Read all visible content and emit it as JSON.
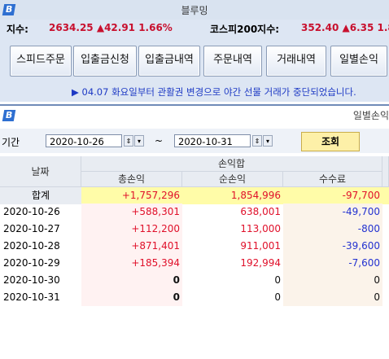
{
  "app": {
    "title": "블루밍",
    "logo_glyph": "B"
  },
  "index_bar": {
    "kospi_label": "지수:",
    "kospi_value": "2634.25 ▲42.91 1.66%",
    "kospi200_label": "코스피200지수:",
    "kospi200_value": "352.40 ▲6.35 1.83"
  },
  "nav": {
    "buttons": [
      "스피드주문",
      "입출금신청",
      "입출금내역",
      "주문내역",
      "거래내역",
      "일별손익"
    ]
  },
  "notice": {
    "text": "▶ 04.07 화요일부터 관활권 변경으로 야간 선물 거래가 중단되었습니다."
  },
  "daily_pl": {
    "window_title": "일별손익",
    "period_label": "기간",
    "start_date": "2020-10-26",
    "separator": "~",
    "end_date": "2020-10-31",
    "query_button": "조회",
    "columns": {
      "date": "날짜",
      "group": "손익합",
      "total_pl": "총손익",
      "net_pl": "순손익",
      "fee": "수수료"
    },
    "total_row": {
      "label": "합계",
      "total_pl": "+1,757,296",
      "net_pl": "1,854,996",
      "fee": "-97,700"
    },
    "rows": [
      {
        "date": "2020-10-26",
        "total_pl": "+588,301",
        "net_pl": "638,001",
        "fee": "-49,700"
      },
      {
        "date": "2020-10-27",
        "total_pl": "+112,200",
        "net_pl": "113,000",
        "fee": "-800"
      },
      {
        "date": "2020-10-28",
        "total_pl": "+871,401",
        "net_pl": "911,001",
        "fee": "-39,600"
      },
      {
        "date": "2020-10-29",
        "total_pl": "+185,394",
        "net_pl": "192,994",
        "fee": "-7,600"
      },
      {
        "date": "2020-10-30",
        "total_pl": "0",
        "net_pl": "0",
        "fee": "0"
      },
      {
        "date": "2020-10-31",
        "total_pl": "0",
        "net_pl": "0",
        "fee": "0"
      }
    ]
  },
  "colors": {
    "positive": "#e0102a",
    "negative": "#2332d0",
    "accent": "#2e6fd1",
    "highlight": "#fffca8"
  }
}
